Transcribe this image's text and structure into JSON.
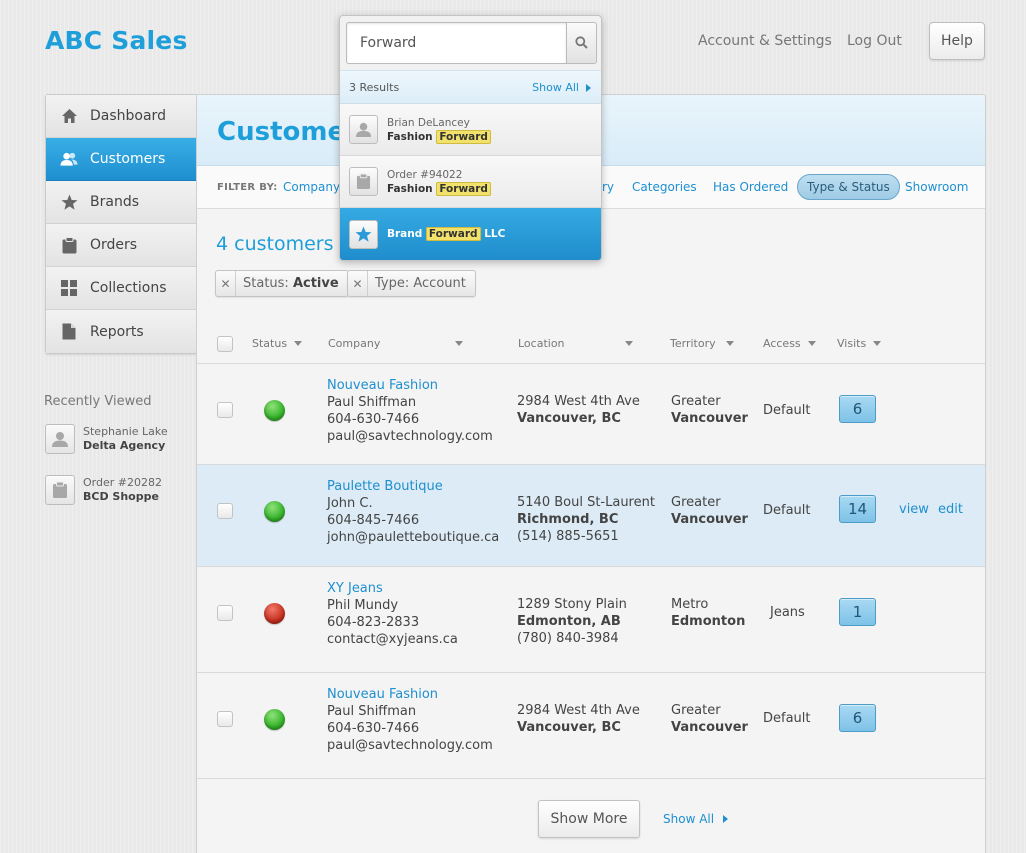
{
  "app": {
    "title": "ABC Sales"
  },
  "topnav": {
    "account": "Account & Settings",
    "logout": "Log Out",
    "help": "Help"
  },
  "search": {
    "value": "Forward",
    "results_count": "3 Results",
    "show_all": "Show All",
    "results": [
      {
        "line1": "Brian DeLancey",
        "line2_pre": "Fashion",
        "line2_hl": "Forward",
        "line2_post": "",
        "icon": "person-icon"
      },
      {
        "line1": "Order #94022",
        "line2_pre": "Fashion",
        "line2_hl": "Forward",
        "line2_post": "",
        "icon": "clipboard-icon"
      },
      {
        "line1": "",
        "line2_pre": "Brand",
        "line2_hl": "Forward",
        "line2_post": "LLC",
        "icon": "star-icon"
      }
    ]
  },
  "sidebar": {
    "items": [
      {
        "label": "Dashboard",
        "icon": "home-icon"
      },
      {
        "label": "Customers",
        "icon": "users-icon",
        "active": true
      },
      {
        "label": "Brands",
        "icon": "star-icon"
      },
      {
        "label": "Orders",
        "icon": "clipboard-icon"
      },
      {
        "label": "Collections",
        "icon": "grid-icon"
      },
      {
        "label": "Reports",
        "icon": "document-icon"
      }
    ],
    "recent_title": "Recently Viewed",
    "recent": [
      {
        "line1": "Stephanie Lake",
        "line2": "Delta Agency",
        "icon": "person-icon"
      },
      {
        "line1": "Order #20282",
        "line2": "BCD Shoppe",
        "icon": "clipboard-icon"
      }
    ]
  },
  "main": {
    "title": "Customers",
    "filter_label": "FILTER BY:",
    "filters": [
      "Company",
      "ry",
      "Categories",
      "Has Ordered",
      "Type & Status",
      "Showroom"
    ],
    "active_filter": "Type & Status",
    "count_title": "4 customers fo",
    "tags": [
      {
        "label": "Status:",
        "value": "Active"
      },
      {
        "label": "Type: Account",
        "value": ""
      }
    ],
    "columns": [
      "Status",
      "Company",
      "Location",
      "Territory",
      "Access",
      "Visits"
    ],
    "rows": [
      {
        "status": "active",
        "status_color": "#35b22a",
        "company": "Nouveau Fashion",
        "contact": "Paul Shiffman",
        "phone": "604-630-7466",
        "email": "paul@savtechnology.com",
        "addr1": "2984 West 4th Ave",
        "addr2": "Vancouver, BC",
        "addr3": "",
        "territory1": "Greater",
        "territory2": "Vancouver",
        "access": "Default",
        "visits": "6"
      },
      {
        "status": "active",
        "status_color": "#35b22a",
        "company": "Paulette Boutique",
        "contact": "John C.",
        "phone": "604-845-7466",
        "email": "john@pauletteboutique.ca",
        "addr1": "5140 Boul St-Laurent",
        "addr2": "Richmond, BC",
        "addr3": "(514) 885-5651",
        "territory1": "Greater",
        "territory2": "Vancouver",
        "access": "Default",
        "visits": "14",
        "view": "view",
        "edit": "edit"
      },
      {
        "status": "inactive",
        "status_color": "#c6301f",
        "company": "XY Jeans",
        "contact": "Phil Mundy",
        "phone": "604-823-2833",
        "email": "contact@xyjeans.ca",
        "addr1": "1289 Stony Plain",
        "addr2": "Edmonton, AB",
        "addr3": "(780) 840-3984",
        "territory1": "Metro",
        "territory2": "Edmonton",
        "access": "Jeans",
        "visits": "1"
      },
      {
        "status": "active",
        "status_color": "#35b22a",
        "company": "Nouveau Fashion",
        "contact": "Paul Shiffman",
        "phone": "604-630-7466",
        "email": "paul@savtechnology.com",
        "addr1": "2984 West 4th Ave",
        "addr2": "Vancouver, BC",
        "addr3": "",
        "territory1": "Greater",
        "territory2": "Vancouver",
        "access": "Default",
        "visits": "6"
      }
    ],
    "show_more": "Show More",
    "show_all": "Show All"
  },
  "colors": {
    "accent": "#1e9fd9",
    "highlight": "#f2e26b",
    "active_row": "#dcebf5"
  }
}
